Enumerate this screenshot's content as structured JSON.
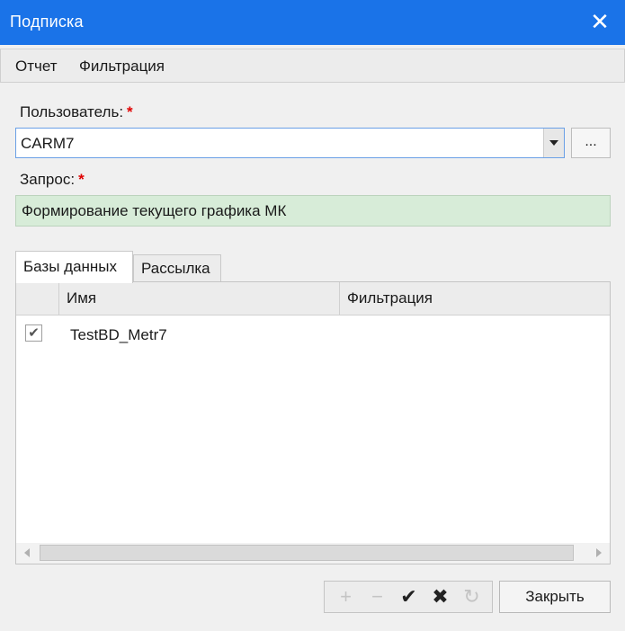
{
  "window": {
    "title": "Подписка",
    "close_glyph": "✕"
  },
  "menu": {
    "items": [
      "Отчет",
      "Фильтрация"
    ]
  },
  "user_field": {
    "label": "Пользователь:",
    "required_mark": "*",
    "value": "CARM7",
    "browse_label": "..."
  },
  "query_field": {
    "label": "Запрос:",
    "required_mark": "*",
    "value": "Формирование текущего графика МК",
    "background": "#d7ecd8"
  },
  "tabs": [
    {
      "label": "Базы данных",
      "active": true
    },
    {
      "label": "Рассылка",
      "active": false
    }
  ],
  "grid": {
    "columns": [
      "",
      "Имя",
      "Фильтрация"
    ],
    "rows": [
      {
        "checked": true,
        "check_glyph": "✔",
        "name": "TestBD_Metr7",
        "filter": ""
      }
    ]
  },
  "toolbar": {
    "buttons": [
      {
        "icon": "plus-icon",
        "glyph": "+",
        "enabled": false
      },
      {
        "icon": "minus-icon",
        "glyph": "−",
        "enabled": false
      },
      {
        "icon": "check-icon",
        "glyph": "✔",
        "enabled": true
      },
      {
        "icon": "cross-icon",
        "glyph": "✖",
        "enabled": true
      },
      {
        "icon": "refresh-icon",
        "glyph": "↻",
        "enabled": false
      }
    ]
  },
  "footer": {
    "close_label": "Закрыть"
  },
  "colors": {
    "titlebar": "#1a73e8",
    "required": "#e00000"
  }
}
